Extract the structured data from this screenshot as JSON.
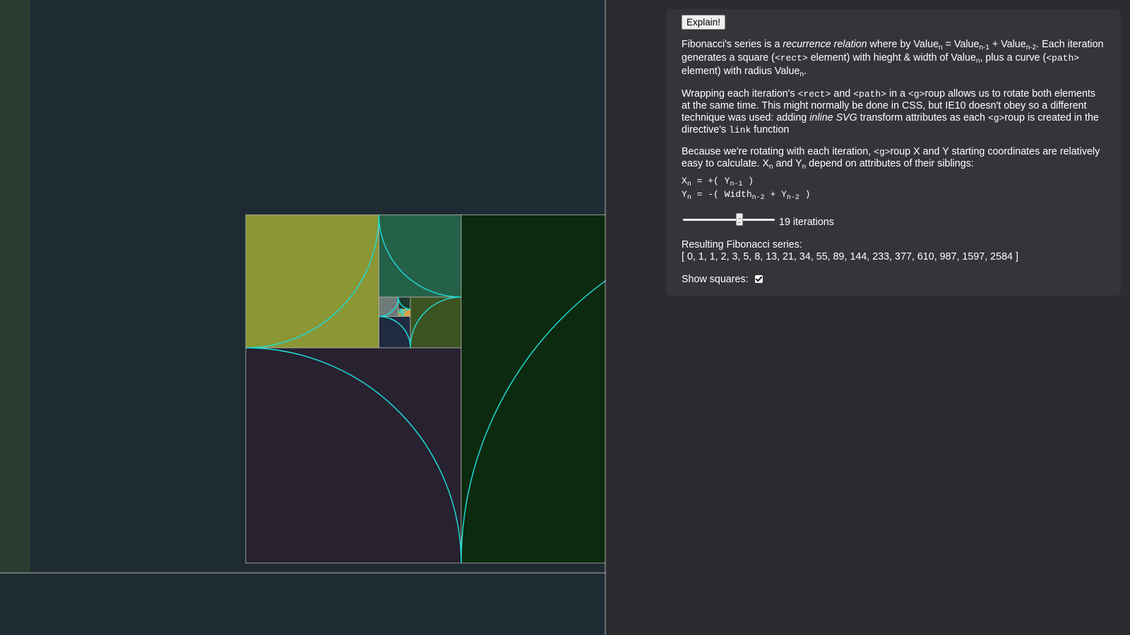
{
  "controls": {
    "explain_label": "Explain!",
    "iterations": 19,
    "iterations_label": "19 iterations",
    "slider_min": 1,
    "slider_max": 40,
    "show_squares_label": "Show squares:",
    "show_squares_checked": true
  },
  "explanation": {
    "p1": {
      "a": "Fibonacci's series is a ",
      "em": "recurrence relation",
      "b": " where by Value",
      "sub_n": "n",
      "c": " = Value",
      "sub_n1": "n-1",
      "d": " + Value",
      "sub_n2": "n-2",
      "e": ". Each iteration generates a square (",
      "code_rect": "<rect>",
      "f": " element) with hieght & width of Value",
      "sub_n3": "n",
      "g": ", plus a curve (",
      "code_path": "<path>",
      "h": " element) with radius Value",
      "sub_n4": "n",
      "i": "."
    },
    "p2": {
      "a": "Wrapping each iteration's ",
      "code_rect": "<rect>",
      "b": " and ",
      "code_path": "<path>",
      "c": " in a ",
      "code_g": "<g>",
      "d": "roup allows us to rotate both elements at the same time. This might normally be done in CSS, but IE10 doesn't obey so a different technique was used: adding ",
      "em": "inline SVG",
      "e": " transform attributes as each ",
      "code_g2": "<g>",
      "f": "roup is created in the directive's ",
      "code_link": "link",
      "g": " function"
    },
    "p3": {
      "a": "Because we're rotating with each iteration, ",
      "code_g": "<g>",
      "b": "roup X and Y starting coordinates are relatively easy to calculate. X",
      "sub_x": "n",
      "c": " and Y",
      "sub_y": "n",
      "d": " depend on attributes of their siblings:"
    },
    "formula1": {
      "a": "X",
      "sub_a": "n",
      "b": " = +( Y",
      "sub_b": "n-1",
      "c": " )"
    },
    "formula2": {
      "a": "Y",
      "sub_a": "n",
      "b": " = -( Width",
      "sub_b": "n-2",
      "c": " + Y",
      "sub_c": "n-2",
      "d": " )"
    }
  },
  "result": {
    "title": "Resulting Fibonacci series:",
    "series_text": "[ 0, 1, 1, 2, 3, 5, 8, 13, 21, 34, 55, 89, 144, 233, 377, 610, 987, 1597, 2584 ]"
  },
  "spiral": {
    "colors": {
      "frame_line": "#b7b3b0",
      "curve": "#1fd9d3",
      "squares": [
        "#3c3a36",
        "#1e2b32",
        "#2a3b2f",
        "#0b2a10",
        "#272130",
        "#256048",
        "#3b5321",
        "#8b9634",
        "#202a40",
        "#6f7b78",
        "#1c3a30",
        "#d8a23e",
        "#9aa54a",
        "#5b7a4a",
        "#4ac3c0",
        "#8a6d3b",
        "#3e5a4c",
        "#c9b65a",
        "#7d8fa0"
      ]
    }
  }
}
